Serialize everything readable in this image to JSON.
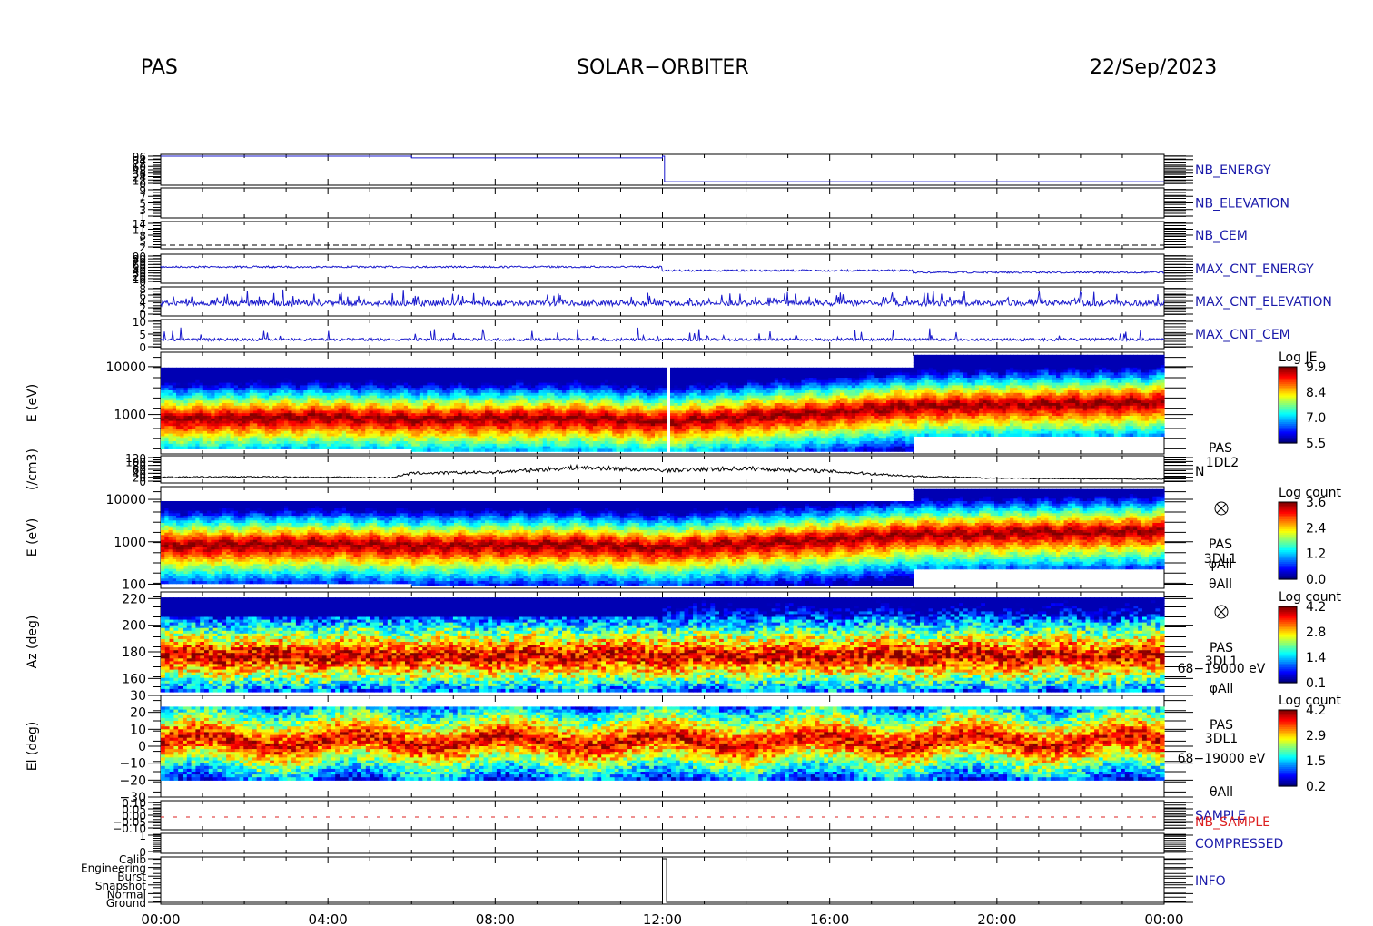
{
  "header": {
    "left": "PAS",
    "center": "SOLAR−ORBITER",
    "right": "22/Sep/2023"
  },
  "colors": {
    "line_blue": "#1a1acc",
    "line_black": "#000000",
    "sample_red": "#dd2222",
    "label_blue": "#1a1aaa"
  },
  "chart_data": {
    "type": "heatmap",
    "x_axis": {
      "tick_labels": [
        "00:00",
        "04:00",
        "08:00",
        "12:00",
        "16:00",
        "20:00",
        "00:00"
      ],
      "range_hours": [
        0,
        24
      ]
    },
    "panels": [
      {
        "id": "nb_energy",
        "right_label": "NB_ENERGY",
        "y_tick_labels": [
          "96",
          "84",
          "72",
          "60",
          "48",
          "36",
          "24",
          "12",
          "0"
        ],
        "series": [
          {
            "x": [
              0,
              6,
              12,
              12.05,
              18,
              24
            ],
            "y": [
              96,
              90,
              96,
              6,
              6,
              6
            ]
          }
        ]
      },
      {
        "id": "nb_elevation",
        "right_label": "NB_ELEVATION",
        "y_tick_labels": [
          "9",
          "7",
          "5",
          "3",
          "1"
        ]
      },
      {
        "id": "nb_cem",
        "right_label": "NB_CEM",
        "y_tick_labels": [
          "14",
          "11",
          "8",
          "5",
          "2"
        ],
        "series": [
          {
            "x": [
              0,
              24
            ],
            "y": [
              2,
              2
            ]
          }
        ]
      },
      {
        "id": "max_cnt_energy",
        "right_label": "MAX_CNT_ENERGY",
        "y_tick_labels": [
          "90",
          "80",
          "70",
          "60",
          "50",
          "40",
          "30",
          "20",
          "10",
          "0"
        ]
      },
      {
        "id": "max_cnt_elevation",
        "right_label": "MAX_CNT_ELEVATION",
        "y_tick_labels": [
          "8",
          "6",
          "4",
          "2",
          "0"
        ]
      },
      {
        "id": "max_cnt_cem",
        "right_label": "MAX_CNT_CEM",
        "y_tick_labels": [
          "10",
          "5",
          "0"
        ]
      },
      {
        "id": "energy_1dl2",
        "y_label": "E (eV)",
        "y_tick_labels": [
          "10000",
          "1000"
        ],
        "y_range": [
          150,
          20000
        ],
        "log_scale": true,
        "side_text": [],
        "colorbar": {
          "title": "Log JE",
          "tick_labels": [
            "9.9",
            "8.4",
            "7.0",
            "5.5"
          ],
          "range": [
            5.5,
            9.9
          ]
        },
        "peak_energy_eV": [
          {
            "x": 0,
            "y": 800
          },
          {
            "x": 4,
            "y": 900
          },
          {
            "x": 6,
            "y": 800
          },
          {
            "x": 10,
            "y": 850
          },
          {
            "x": 12,
            "y": 700
          },
          {
            "x": 16,
            "y": 1100
          },
          {
            "x": 18,
            "y": 1500
          },
          {
            "x": 24,
            "y": 1800
          }
        ]
      },
      {
        "id": "density",
        "y_label": "(/cm3)",
        "y_tick_labels": [
          "120",
          "100",
          "80",
          "60",
          "40",
          "20",
          "0"
        ],
        "side_text": [
          "PAS",
          "1DL2"
        ],
        "right_label": "N",
        "series": [
          {
            "x": [
              0,
              2,
              4,
              5.5,
              6,
              8,
              10,
              12,
              13,
              14,
              16,
              18,
              20,
              22,
              24
            ],
            "y": [
              20,
              22,
              20,
              18,
              40,
              45,
              70,
              55,
              60,
              65,
              50,
              25,
              15,
              12,
              10
            ]
          }
        ]
      },
      {
        "id": "energy_3dl1",
        "y_label": "E (eV)",
        "y_tick_labels": [
          "10000",
          "1000",
          "100"
        ],
        "y_range": [
          80,
          20000
        ],
        "log_scale": true,
        "side_text": [
          "PAS",
          "3DL1",
          "φAll",
          "θAll"
        ],
        "colorbar": {
          "title": "Log count",
          "tick_labels": [
            "3.6",
            "2.4",
            "1.2",
            "0.0"
          ],
          "range": [
            0,
            3.6
          ]
        }
      },
      {
        "id": "azimuth",
        "y_label": "Az (deg)",
        "y_tick_labels": [
          "220",
          "200",
          "180",
          "160"
        ],
        "y_range": [
          150,
          225
        ],
        "side_text": [
          "PAS",
          "3DL1",
          "68−19000 eV",
          "φAll"
        ],
        "colorbar": {
          "title": "Log count",
          "tick_labels": [
            "4.2",
            "2.8",
            "1.4",
            "0.1"
          ],
          "range": [
            0.1,
            4.2
          ]
        }
      },
      {
        "id": "elevation",
        "y_label": "El (deg)",
        "y_tick_labels": [
          "30",
          "20",
          "10",
          "0",
          "−10",
          "−20",
          "−30"
        ],
        "y_range": [
          -30,
          30
        ],
        "side_text": [
          "PAS",
          "3DL1",
          "68−19000 eV",
          "θAll"
        ],
        "colorbar": {
          "title": "Log count",
          "tick_labels": [
            "4.2",
            "2.9",
            "1.5",
            "0.2"
          ],
          "range": [
            0.2,
            4.2
          ]
        }
      },
      {
        "id": "sample",
        "right_label": "SAMPLE",
        "right_label_2": "NB_SAMPLE",
        "y_tick_labels": [
          "0.10",
          "0.05",
          "0.00",
          "−0.05",
          "−0.10"
        ]
      },
      {
        "id": "compressed",
        "right_label": "COMPRESSED",
        "y_tick_labels": [
          "1",
          "0"
        ]
      },
      {
        "id": "info",
        "right_label": "INFO",
        "y_tick_labels": [
          "Calib",
          "Engineering",
          "Burst",
          "Snapshot",
          "Normal",
          "Ground"
        ],
        "series": [
          {
            "x": [
              0,
              12,
              12,
              12.1,
              12.1,
              24
            ],
            "y": [
              0,
              0,
              5,
              5,
              0,
              0
            ]
          }
        ]
      }
    ]
  }
}
